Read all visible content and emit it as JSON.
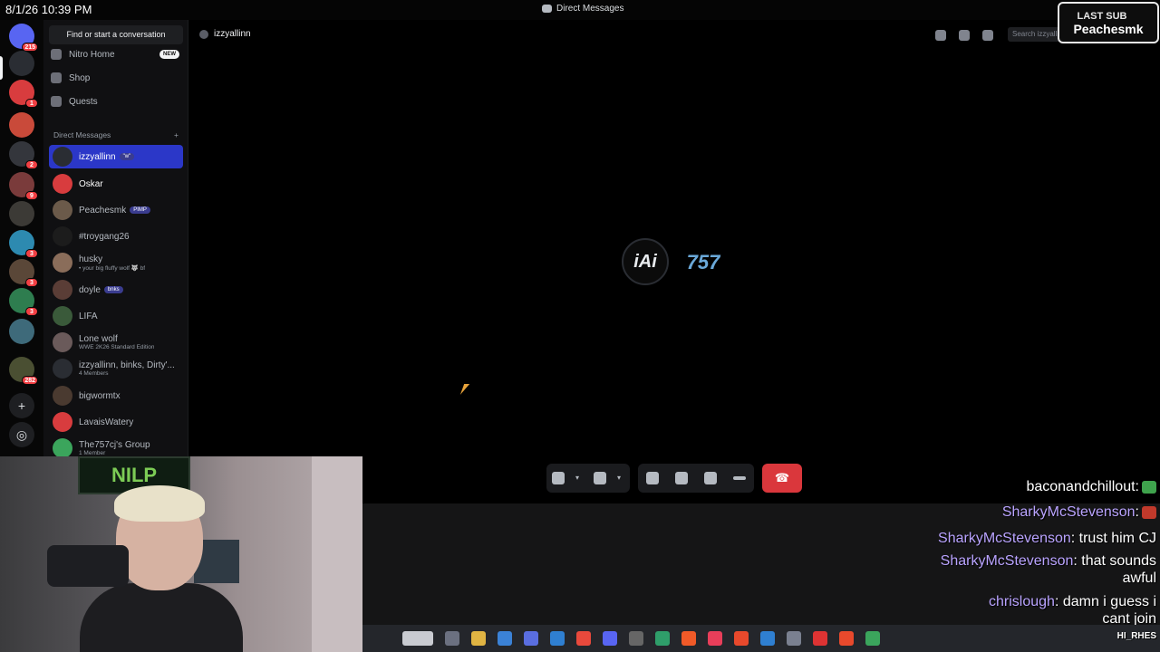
{
  "titlebar": {
    "clock": "8/1/26 10:39 PM",
    "window_title": "Direct Messages"
  },
  "rail": {
    "servers": [
      {
        "name": "discord-home",
        "badge": "215",
        "color": "#5865f2"
      },
      {
        "name": "iai-server",
        "badge": "",
        "color": "#2a2d33"
      },
      {
        "name": "server-red",
        "badge": "1",
        "color": "#d83c3e"
      },
      {
        "name": "server-popcorn",
        "badge": "",
        "color": "#c94a3a"
      },
      {
        "name": "server-4",
        "badge": "2",
        "color": "#34363c"
      },
      {
        "name": "server-5",
        "badge": "9",
        "color": "#7a3b3b"
      },
      {
        "name": "server-6",
        "badge": "",
        "color": "#3c3a36"
      },
      {
        "name": "server-7",
        "badge": "3",
        "color": "#2d8ab0"
      },
      {
        "name": "server-8",
        "badge": "3",
        "color": "#5a4738"
      },
      {
        "name": "server-kick",
        "badge": "3",
        "color": "#2e7d4f"
      },
      {
        "name": "server-10",
        "badge": "",
        "color": "#3e6a7a"
      },
      {
        "name": "server-11",
        "badge": "282",
        "color": "#4a4f32"
      }
    ]
  },
  "sidebar": {
    "search_label": "Find or start a conversation",
    "nav": [
      {
        "label": "Nitro Home",
        "badge": "NEW"
      },
      {
        "label": "Shop",
        "badge": ""
      },
      {
        "label": "Quests",
        "badge": ""
      }
    ],
    "dm_header": "Direct Messages",
    "dm_add": "+",
    "dms": [
      {
        "name": "izzyallinn",
        "tag": "\"w\"",
        "sub": "",
        "color": "#2a2d33"
      },
      {
        "name": "Oskar",
        "tag": "",
        "sub": "",
        "color": "#d83c3e"
      },
      {
        "name": "Peachesmk",
        "tag": "PIMP",
        "sub": "",
        "color": "#6b5a4a"
      },
      {
        "name": "#troygang26",
        "tag": "",
        "sub": "",
        "color": "#1c1c1c"
      },
      {
        "name": "husky",
        "tag": "",
        "sub": "• your big fluffy wolf 🐺 bf",
        "color": "#8a6d5a"
      },
      {
        "name": "doyle",
        "tag": "bnks",
        "sub": "",
        "color": "#5a3d36"
      },
      {
        "name": "LIFA",
        "tag": "",
        "sub": "",
        "color": "#3a5a3a"
      },
      {
        "name": "Lone wolf",
        "tag": "",
        "sub": "WWE 2K26 Standard Edition",
        "color": "#6a5a5a"
      },
      {
        "name": "izzyallinn, binks, Dirty'...",
        "tag": "",
        "sub": "4 Members",
        "color": "#2a2d33"
      },
      {
        "name": "bigwormtx",
        "tag": "",
        "sub": "",
        "color": "#4a3a30"
      },
      {
        "name": "LavaisWatery",
        "tag": "",
        "sub": "",
        "color": "#d83c3e"
      },
      {
        "name": "The757cj's Group",
        "tag": "",
        "sub": "1 Member",
        "color": "#3ba55c"
      }
    ]
  },
  "call": {
    "title": "izzyallinn",
    "search_placeholder": "Search izzyallinn",
    "logo_left": "iAi",
    "logo_right": "757",
    "hangup_icon": "☎"
  },
  "chat": {
    "messages": [
      {
        "user": "baconandchillout",
        "text": "",
        "emote": "#3fa34d"
      },
      {
        "user": "SharkyMcStevenson",
        "text": "",
        "emote": "#c0392b"
      },
      {
        "user": "SharkyMcStevenson",
        "text": ": trust him CJ",
        "emote": ""
      },
      {
        "user": "SharkyMcStevenson",
        "text": ": that sounds",
        "emote": ""
      },
      {
        "user": "",
        "text": "awful",
        "emote": ""
      },
      {
        "user": "chrislough",
        "text": ": damn i guess i",
        "emote": ""
      },
      {
        "user": "",
        "text": "cant join",
        "emote": ""
      }
    ]
  },
  "last_sub": {
    "label": "LAST SUB",
    "name": "Peachesmk"
  },
  "cam": {
    "poster_text": "NILP"
  },
  "taskbar": {
    "right_text": "HI_RHES"
  }
}
